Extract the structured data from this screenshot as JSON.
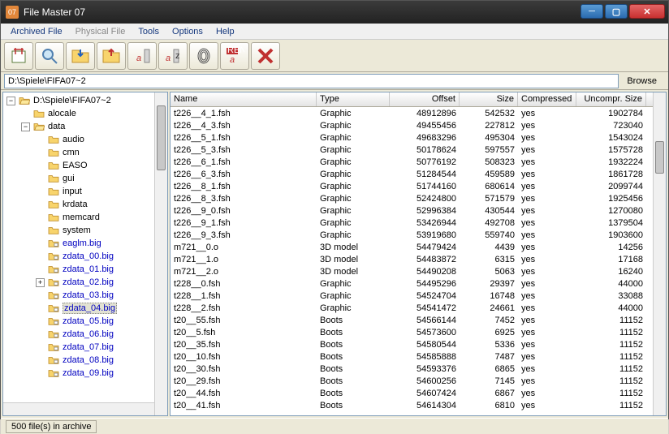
{
  "window": {
    "title": "File Master 07"
  },
  "menu": {
    "items": [
      "Archived File",
      "Physical File",
      "Tools",
      "Options",
      "Help"
    ],
    "disabled_index": 1
  },
  "toolbar": {
    "buttons": [
      "extract",
      "search",
      "import-folder",
      "export-folder",
      "compress-a",
      "compress-z",
      "fingerprint",
      "rename",
      "delete"
    ]
  },
  "path": {
    "value": "D:\\Spiele\\FIFA07~2",
    "browse": "Browse"
  },
  "tree": {
    "root": "D:\\Spiele\\FIFA07~2",
    "nodes": [
      {
        "depth": 0,
        "ex": "-",
        "icon": "folder-open",
        "label": "D:\\Spiele\\FIFA07~2",
        "blue": false
      },
      {
        "depth": 1,
        "ex": "",
        "icon": "folder",
        "label": "alocale",
        "blue": false
      },
      {
        "depth": 1,
        "ex": "-",
        "icon": "folder-open",
        "label": "data",
        "blue": false
      },
      {
        "depth": 2,
        "ex": "",
        "icon": "folder",
        "label": "audio",
        "blue": false
      },
      {
        "depth": 2,
        "ex": "",
        "icon": "folder",
        "label": "cmn",
        "blue": false
      },
      {
        "depth": 2,
        "ex": "",
        "icon": "folder",
        "label": "EASO",
        "blue": false
      },
      {
        "depth": 2,
        "ex": "",
        "icon": "folder",
        "label": "gui",
        "blue": false
      },
      {
        "depth": 2,
        "ex": "",
        "icon": "folder",
        "label": "input",
        "blue": false
      },
      {
        "depth": 2,
        "ex": "",
        "icon": "folder",
        "label": "krdata",
        "blue": false
      },
      {
        "depth": 2,
        "ex": "",
        "icon": "folder",
        "label": "memcard",
        "blue": false
      },
      {
        "depth": 2,
        "ex": "",
        "icon": "folder",
        "label": "system",
        "blue": false
      },
      {
        "depth": 2,
        "ex": "",
        "icon": "bigfile",
        "label": "eaglm.big",
        "blue": true
      },
      {
        "depth": 2,
        "ex": "",
        "icon": "bigfile",
        "label": "zdata_00.big",
        "blue": true
      },
      {
        "depth": 2,
        "ex": "",
        "icon": "bigfile",
        "label": "zdata_01.big",
        "blue": true
      },
      {
        "depth": 2,
        "ex": "+",
        "icon": "bigfile",
        "label": "zdata_02.big",
        "blue": true
      },
      {
        "depth": 2,
        "ex": "",
        "icon": "bigfile",
        "label": "zdata_03.big",
        "blue": true
      },
      {
        "depth": 2,
        "ex": "",
        "icon": "bigfile",
        "label": "zdata_04.big",
        "blue": true,
        "sel": true
      },
      {
        "depth": 2,
        "ex": "",
        "icon": "bigfile",
        "label": "zdata_05.big",
        "blue": true
      },
      {
        "depth": 2,
        "ex": "",
        "icon": "bigfile",
        "label": "zdata_06.big",
        "blue": true
      },
      {
        "depth": 2,
        "ex": "",
        "icon": "bigfile",
        "label": "zdata_07.big",
        "blue": true
      },
      {
        "depth": 2,
        "ex": "",
        "icon": "bigfile",
        "label": "zdata_08.big",
        "blue": true
      },
      {
        "depth": 2,
        "ex": "",
        "icon": "bigfile",
        "label": "zdata_09.big",
        "blue": true
      }
    ]
  },
  "list": {
    "columns": [
      "Name",
      "Type",
      "Offset",
      "Size",
      "Compressed",
      "Uncompr. Size"
    ],
    "rows": [
      {
        "n": "t226__4_1.fsh",
        "t": "Graphic",
        "o": "48912896",
        "s": "542532",
        "c": "yes",
        "u": "1902784"
      },
      {
        "n": "t226__4_3.fsh",
        "t": "Graphic",
        "o": "49455456",
        "s": "227812",
        "c": "yes",
        "u": "723040"
      },
      {
        "n": "t226__5_1.fsh",
        "t": "Graphic",
        "o": "49683296",
        "s": "495304",
        "c": "yes",
        "u": "1543024"
      },
      {
        "n": "t226__5_3.fsh",
        "t": "Graphic",
        "o": "50178624",
        "s": "597557",
        "c": "yes",
        "u": "1575728"
      },
      {
        "n": "t226__6_1.fsh",
        "t": "Graphic",
        "o": "50776192",
        "s": "508323",
        "c": "yes",
        "u": "1932224"
      },
      {
        "n": "t226__6_3.fsh",
        "t": "Graphic",
        "o": "51284544",
        "s": "459589",
        "c": "yes",
        "u": "1861728"
      },
      {
        "n": "t226__8_1.fsh",
        "t": "Graphic",
        "o": "51744160",
        "s": "680614",
        "c": "yes",
        "u": "2099744"
      },
      {
        "n": "t226__8_3.fsh",
        "t": "Graphic",
        "o": "52424800",
        "s": "571579",
        "c": "yes",
        "u": "1925456"
      },
      {
        "n": "t226__9_0.fsh",
        "t": "Graphic",
        "o": "52996384",
        "s": "430544",
        "c": "yes",
        "u": "1270080"
      },
      {
        "n": "t226__9_1.fsh",
        "t": "Graphic",
        "o": "53426944",
        "s": "492708",
        "c": "yes",
        "u": "1379504"
      },
      {
        "n": "t226__9_3.fsh",
        "t": "Graphic",
        "o": "53919680",
        "s": "559740",
        "c": "yes",
        "u": "1903600"
      },
      {
        "n": "m721__0.o",
        "t": "3D model",
        "o": "54479424",
        "s": "4439",
        "c": "yes",
        "u": "14256"
      },
      {
        "n": "m721__1.o",
        "t": "3D model",
        "o": "54483872",
        "s": "6315",
        "c": "yes",
        "u": "17168"
      },
      {
        "n": "m721__2.o",
        "t": "3D model",
        "o": "54490208",
        "s": "5063",
        "c": "yes",
        "u": "16240"
      },
      {
        "n": "t228__0.fsh",
        "t": "Graphic",
        "o": "54495296",
        "s": "29397",
        "c": "yes",
        "u": "44000"
      },
      {
        "n": "t228__1.fsh",
        "t": "Graphic",
        "o": "54524704",
        "s": "16748",
        "c": "yes",
        "u": "33088"
      },
      {
        "n": "t228__2.fsh",
        "t": "Graphic",
        "o": "54541472",
        "s": "24661",
        "c": "yes",
        "u": "44000"
      },
      {
        "n": "t20__55.fsh",
        "t": "Boots",
        "o": "54566144",
        "s": "7452",
        "c": "yes",
        "u": "11152"
      },
      {
        "n": "t20__5.fsh",
        "t": "Boots",
        "o": "54573600",
        "s": "6925",
        "c": "yes",
        "u": "11152"
      },
      {
        "n": "t20__35.fsh",
        "t": "Boots",
        "o": "54580544",
        "s": "5336",
        "c": "yes",
        "u": "11152"
      },
      {
        "n": "t20__10.fsh",
        "t": "Boots",
        "o": "54585888",
        "s": "7487",
        "c": "yes",
        "u": "11152"
      },
      {
        "n": "t20__30.fsh",
        "t": "Boots",
        "o": "54593376",
        "s": "6865",
        "c": "yes",
        "u": "11152"
      },
      {
        "n": "t20__29.fsh",
        "t": "Boots",
        "o": "54600256",
        "s": "7145",
        "c": "yes",
        "u": "11152"
      },
      {
        "n": "t20__44.fsh",
        "t": "Boots",
        "o": "54607424",
        "s": "6867",
        "c": "yes",
        "u": "11152"
      },
      {
        "n": "t20__41.fsh",
        "t": "Boots",
        "o": "54614304",
        "s": "6810",
        "c": "yes",
        "u": "11152"
      }
    ]
  },
  "status": {
    "text": "500 file(s) in archive"
  }
}
